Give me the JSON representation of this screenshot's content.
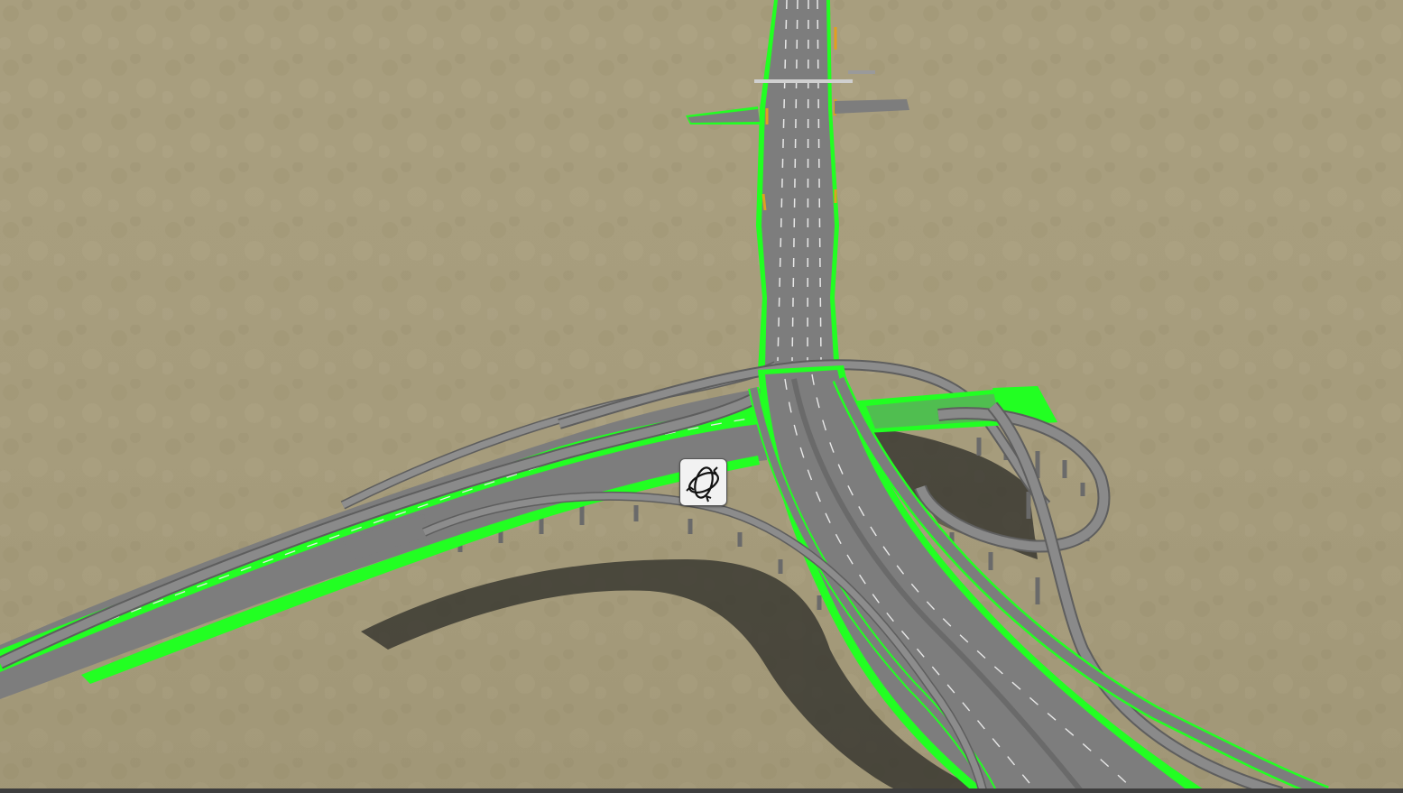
{
  "app": {
    "view": "3d-road-editor-viewport"
  },
  "colors": {
    "terrain": "#a89e7e",
    "terrain_dark": "#9a9070",
    "road_surface": "#7d7d7d",
    "road_edge": "#5e5e5e",
    "highlight": "#22ff22",
    "lane_marking": "#e8e8e8",
    "center_marking": "#e0a020",
    "shadow": "#2a2a2a",
    "pillar": "#6a6a6a"
  },
  "icons": {
    "gizmo": "transform-gizmo-icon"
  }
}
